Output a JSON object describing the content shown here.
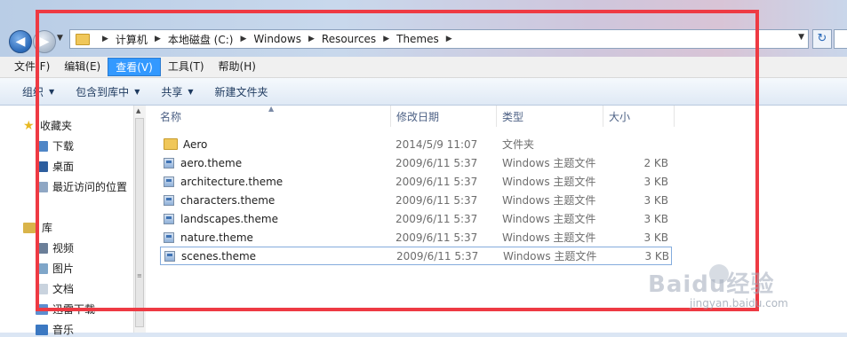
{
  "address_bar": {
    "crumbs": [
      "计算机",
      "本地磁盘 (C:)",
      "Windows",
      "Resources",
      "Themes"
    ]
  },
  "menu": [
    "文件(F)",
    "编辑(E)",
    "查看(V)",
    "工具(T)",
    "帮助(H)"
  ],
  "menu_active": "查看(V)",
  "command_bar": {
    "organize": "组织",
    "include_in_library": "包含到库中",
    "share": "共享",
    "new_folder": "新建文件夹"
  },
  "nav": {
    "favorites": "收藏夹",
    "downloads": "下载",
    "desktop": "桌面",
    "recent": "最近访问的位置",
    "libraries": "库",
    "videos": "视频",
    "pictures": "图片",
    "documents": "文档",
    "thunder": "迅雷下载",
    "music": "音乐"
  },
  "columns": {
    "name": "名称",
    "date": "修改日期",
    "type": "类型",
    "size": "大小"
  },
  "files": [
    {
      "name": "Aero",
      "date": "2014/5/9 11:07",
      "type": "文件夹",
      "size": "",
      "icon": "folder-icon"
    },
    {
      "name": "aero.theme",
      "date": "2009/6/11 5:37",
      "type": "Windows 主题文件",
      "size": "2 KB",
      "icon": "theme-file-icon"
    },
    {
      "name": "architecture.theme",
      "date": "2009/6/11 5:37",
      "type": "Windows 主题文件",
      "size": "3 KB",
      "icon": "theme-file-icon"
    },
    {
      "name": "characters.theme",
      "date": "2009/6/11 5:37",
      "type": "Windows 主题文件",
      "size": "3 KB",
      "icon": "theme-file-icon"
    },
    {
      "name": "landscapes.theme",
      "date": "2009/6/11 5:37",
      "type": "Windows 主题文件",
      "size": "3 KB",
      "icon": "theme-file-icon"
    },
    {
      "name": "nature.theme",
      "date": "2009/6/11 5:37",
      "type": "Windows 主题文件",
      "size": "3 KB",
      "icon": "theme-file-icon"
    },
    {
      "name": "scenes.theme",
      "date": "2009/6/11 5:37",
      "type": "Windows 主题文件",
      "size": "3 KB",
      "icon": "theme-file-icon"
    }
  ],
  "selected_file": "scenes.theme",
  "watermark": {
    "logo": "Baidu经验",
    "url": "jingyan.baidu.com"
  },
  "colors": {
    "annotation": "#ee3a43",
    "menu_active": "#3399ff",
    "column_header_text": "#4d6185"
  }
}
